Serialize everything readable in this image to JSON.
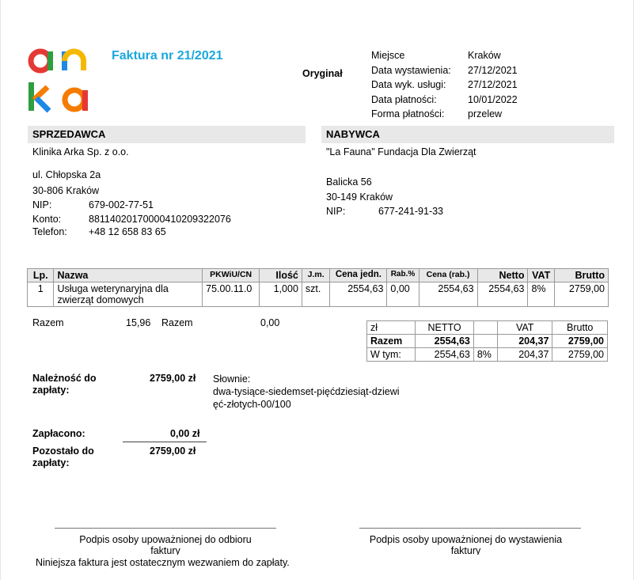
{
  "logo": {
    "text": "arka",
    "colors": {
      "red": "#e53935",
      "green": "#2e9e3e",
      "yellow": "#f5b800",
      "blue": "#1e88e5",
      "orange": "#f57c00"
    }
  },
  "invoice": {
    "title": "Faktura nr 21/2021",
    "copy_label": "Oryginał"
  },
  "meta": [
    {
      "label": "Miejsce",
      "value": "Kraków"
    },
    {
      "label": "Data wystawienia:",
      "value": "27/12/2021"
    },
    {
      "label": "Data wyk. usługi:",
      "value": "27/12/2021"
    },
    {
      "label": "Data płatności:",
      "value": "10/01/2022"
    },
    {
      "label": "Forma płatności:",
      "value": "przelew"
    }
  ],
  "seller": {
    "header": "SPRZEDAWCA",
    "name": "Klinika Arka Sp. z o.o.",
    "street": "ul. Chłopska 2a",
    "city": "30-806 Kraków",
    "nip_label": "NIP:",
    "nip": "679-002-77-51",
    "account_label": "Konto:",
    "account": "88114020170000410209322076",
    "phone_label": "Telefon:",
    "phone": "+48 12 658 83 65"
  },
  "buyer": {
    "header": "NABYWCA",
    "name": "\"La Fauna\" Fundacja Dla Zwierząt",
    "street": "Balicka 56",
    "city": "30-149 Kraków",
    "nip_label": "NIP:",
    "nip": "677-241-91-33"
  },
  "items_table": {
    "headers": {
      "lp": "Lp.",
      "name": "Nazwa",
      "pkwiu": "PKWiU/CN",
      "qty": "Ilość",
      "unit": "J.m.",
      "unit_price": "Cena jedn.",
      "discount": "Rab.%",
      "disc_price": "Cena (rab.)",
      "net": "Netto",
      "vat": "VAT",
      "gross": "Brutto"
    },
    "rows": [
      {
        "lp": "1",
        "name_line1": "Usługa weterynaryjna dla",
        "name_line2": "zwierząt domowych",
        "pkwiu": "75.00.11.0",
        "qty": "1,000",
        "unit": "szt.",
        "unit_price": "2554,63",
        "discount": "0,00",
        "disc_price": "2554,63",
        "net": "2554,63",
        "vat": "8%",
        "gross": "2759,00"
      }
    ]
  },
  "razem_left": {
    "label1": "Razem",
    "value1": "15,96",
    "label2": "Razem",
    "value2": "0,00"
  },
  "summary": {
    "headers": {
      "currency": "zł",
      "net": "NETTO",
      "vat": "VAT",
      "gross": "Brutto"
    },
    "total": {
      "label": "Razem",
      "net": "2554,63",
      "vat": "204,37",
      "gross": "2759,00"
    },
    "breakdown": {
      "label": "W tym:",
      "net": "2554,63",
      "rate": "8%",
      "vat": "204,37",
      "gross": "2759,00"
    }
  },
  "due": {
    "label_line1": "Należność do",
    "label_line2": "zapłaty:",
    "amount": "2759,00 zł",
    "words_label": "Słownie:",
    "words_line1": "dwa-tysiące-siedemset-pięćdziesiąt-dziewi",
    "words_line2": "ęć-złotych-00/100"
  },
  "paid": {
    "label": "Zapłacono:",
    "amount": "0,00 zł"
  },
  "remaining": {
    "label_line1": "Pozostało do",
    "label_line2": "zapłaty:",
    "amount": "2759,00 zł"
  },
  "signatures": {
    "left_line1": "Podpis osoby upoważnionej do odbioru",
    "left_line2": "faktury",
    "right_line1": "Podpis osoby upoważnionej do wystawienia",
    "right_line2": "faktury"
  },
  "footer_note": "Niniejsza faktura jest ostatecznym wezwaniem do zapłaty."
}
